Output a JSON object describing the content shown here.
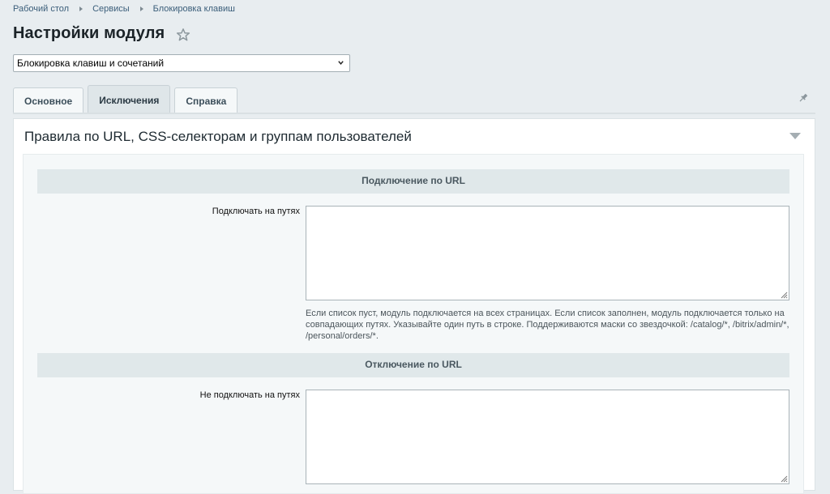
{
  "breadcrumb": {
    "items": [
      "Рабочий стол",
      "Сервисы",
      "Блокировка клавиш"
    ]
  },
  "page": {
    "title": "Настройки модуля"
  },
  "module_select": {
    "selected": "Блокировка клавиш и сочетаний"
  },
  "tabs": [
    {
      "label": "Основное",
      "active": false
    },
    {
      "label": "Исключения",
      "active": true
    },
    {
      "label": "Справка",
      "active": false
    }
  ],
  "panel": {
    "title": "Правила по URL, CSS-селекторам и группам пользователей"
  },
  "sections": {
    "include": {
      "heading": "Подключение по URL",
      "field_label": "Подключать на путях",
      "value": "",
      "hint": "Если список пуст, модуль подключается на всех страницах. Если список заполнен, модуль подключается только на совпадающих путях. Указывайте один путь в строке. Поддерживаются маски со звездочкой: /catalog/*, /bitrix/admin/*, /personal/orders/*."
    },
    "exclude": {
      "heading": "Отключение по URL",
      "field_label": "Не подключать на путях",
      "value": ""
    }
  },
  "icons": {
    "favorite": "star-icon",
    "pin": "pin-icon",
    "collapse": "triangle-down-icon",
    "dropdown": "chevron-down-icon"
  },
  "colors": {
    "background": "#e8edf0",
    "link": "#3b5e7a",
    "section_header": "#e0e8ea"
  }
}
